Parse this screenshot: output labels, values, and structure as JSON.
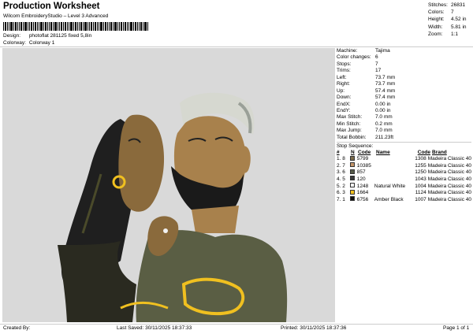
{
  "header": {
    "title": "Production Worksheet",
    "subtitle": "Wilcom EmbroideryStudio – Level 3 Advanced",
    "design_label": "Design:",
    "design_value": "photoflat 281125 fixed 5,8in",
    "colorway_label": "Colorway:",
    "colorway_value": "Colorway 1"
  },
  "stats": [
    {
      "key": "Stitches:",
      "value": "26831"
    },
    {
      "key": "Colors:",
      "value": "7"
    },
    {
      "key": "Height:",
      "value": "4.52 in"
    },
    {
      "key": "Width:",
      "value": "5.81 in"
    },
    {
      "key": "Zoom:",
      "value": "1:1"
    }
  ],
  "machine": [
    {
      "key": "Machine:",
      "value": "Tajima"
    },
    {
      "key": "Color changes:",
      "value": "6"
    },
    {
      "key": "Stops:",
      "value": "7"
    },
    {
      "key": "Trims:",
      "value": "17"
    },
    {
      "key": "Left:",
      "value": "73.7 mm"
    },
    {
      "key": "Right:",
      "value": "73.7 mm"
    },
    {
      "key": "Up:",
      "value": "57.4 mm"
    },
    {
      "key": "Down:",
      "value": "57.4 mm"
    },
    {
      "key": "EndX:",
      "value": "0.00 in"
    },
    {
      "key": "EndY:",
      "value": "0.00 in"
    },
    {
      "key": "Max Stitch:",
      "value": "7.0 mm"
    },
    {
      "key": "Min Stitch:",
      "value": "0.2 mm"
    },
    {
      "key": "Max Jump:",
      "value": "7.0 mm"
    },
    {
      "key": "Total Bobbin:",
      "value": "211.23ft"
    }
  ],
  "stop_sequence": {
    "title": "Stop Sequence:",
    "headers": {
      "num": "#",
      "n": "N",
      "code": "Code",
      "name": "Name",
      "stitches": "Code",
      "brand": "Brand"
    },
    "rows": [
      {
        "num": "1.",
        "n": "8",
        "color": "#7a6a4a",
        "code": "5799",
        "name": "",
        "stitches": "1308",
        "brand": "Madeira Classic 40"
      },
      {
        "num": "2.",
        "n": "7",
        "color": "#c4956a",
        "code": "10385",
        "name": "",
        "stitches": "1255",
        "brand": "Madeira Classic 40"
      },
      {
        "num": "3.",
        "n": "6",
        "color": "#555a48",
        "code": "857",
        "name": "",
        "stitches": "1250",
        "brand": "Madeira Classic 40"
      },
      {
        "num": "4.",
        "n": "5",
        "color": "#3a3a3a",
        "code": "120",
        "name": "",
        "stitches": "1043",
        "brand": "Madeira Classic 40"
      },
      {
        "num": "5.",
        "n": "2",
        "color": "#f2f2f2",
        "code": "1248",
        "name": "Natural White",
        "stitches": "1004",
        "brand": "Madeira Classic 40"
      },
      {
        "num": "6.",
        "n": "3",
        "color": "#f0c020",
        "code": "1664",
        "name": "",
        "stitches": "1124",
        "brand": "Madeira Classic 40"
      },
      {
        "num": "7.",
        "n": "1",
        "color": "#111111",
        "code": "6756",
        "name": "Amber Black",
        "stitches": "1007",
        "brand": "Madeira Classic 40"
      }
    ]
  },
  "footer": {
    "created": "Created By:",
    "saved": "Last Saved: 30/11/2025 18:37:33",
    "printed": "Printed: 30/11/2025 18:37:36",
    "page": "Page 1 of 1"
  }
}
